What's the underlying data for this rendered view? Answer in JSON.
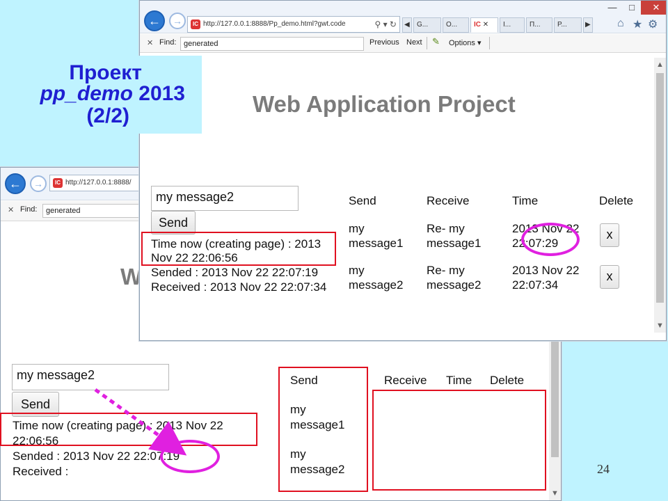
{
  "slide": {
    "title_line1": "Проект",
    "title_line2_italic": "pp_demo",
    "title_line2_rest": " 2013",
    "title_line3": "(2/2)",
    "page_number": "24",
    "accent_colors": {
      "title": "#1f1fd1",
      "highlight_box": "#e01020",
      "oval": "#e020e0",
      "background": "#bff3ff"
    }
  },
  "front": {
    "url": "http://127.0.0.1:8888/Pp_demo.html?gwt.code",
    "tabs": [
      "G...",
      "O...",
      "",
      "I...",
      "П...",
      "P..."
    ],
    "find": {
      "label": "Find:",
      "value": "generated",
      "prev": "Previous",
      "next": "Next",
      "options": "Options"
    },
    "page_title": "Web Application Project",
    "input_value": "my message2",
    "send_label": "Send",
    "status_lines": [
      "Time now (creating page) : 2013",
      "Nov 22 22:06:56",
      "Sended : 2013 Nov 22 22:07:19",
      "Received : 2013 Nov 22 22:07:34"
    ],
    "table": {
      "headers": [
        "Send",
        "Receive",
        "Time",
        "Delete"
      ],
      "rows": [
        {
          "send": [
            "my",
            "message1"
          ],
          "receive": [
            "Re- my",
            "message1"
          ],
          "time": [
            "2013 Nov 22",
            "22:07:29"
          ],
          "delete": "x"
        },
        {
          "send": [
            "my",
            "message2"
          ],
          "receive": [
            "Re- my",
            "message2"
          ],
          "time": [
            "2013 Nov 22",
            "22:07:34"
          ],
          "delete": "x"
        }
      ]
    }
  },
  "back": {
    "url": "http://127.0.0.1:8888/",
    "find": {
      "label": "Find:",
      "value": "generated"
    },
    "page_title_fragment": "W",
    "input_value": "my message2",
    "send_label": "Send",
    "status_lines": [
      "Time now (creating page) : 2013 Nov 22",
      "22:06:56",
      "Sended : 2013 Nov 22 22:07:19",
      "Received :"
    ],
    "table": {
      "headers": [
        "Send",
        "Receive",
        "Time",
        "Delete"
      ],
      "send_values": [
        [
          "my",
          "message1"
        ],
        [
          "my",
          "message2"
        ]
      ]
    }
  }
}
